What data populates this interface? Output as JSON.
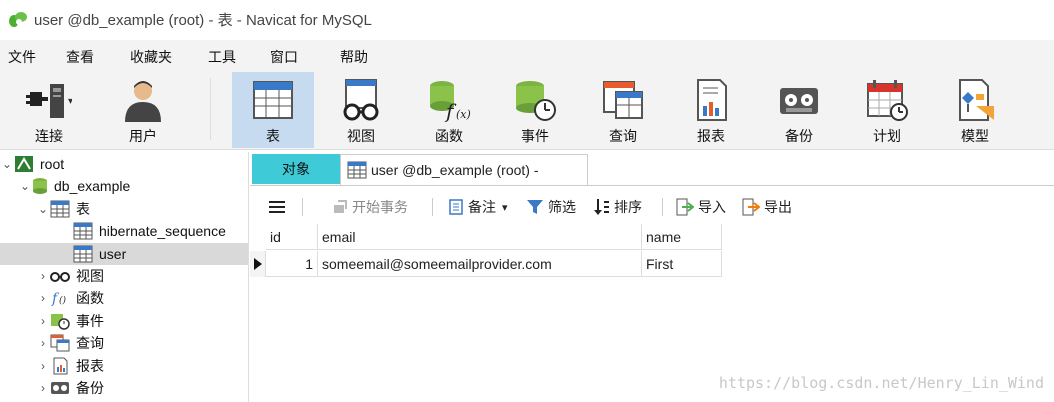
{
  "window": {
    "title": "user @db_example (root) - 表 - Navicat for MySQL"
  },
  "menu": [
    "文件",
    "查看",
    "收藏夹",
    "工具",
    "窗口",
    "帮助"
  ],
  "toolbar": {
    "connect": "连接",
    "user": "用户",
    "table": "表",
    "view": "视图",
    "function": "函数",
    "event": "事件",
    "query": "查询",
    "report": "报表",
    "backup": "备份",
    "schedule": "计划",
    "model": "模型"
  },
  "tree": {
    "root": "root",
    "database": "db_example",
    "tables_group": "表",
    "tables": [
      "hibernate_sequence",
      "user"
    ],
    "views": "视图",
    "functions": "函数",
    "events": "事件",
    "queries": "查询",
    "reports": "报表",
    "backups": "备份"
  },
  "tabs": {
    "objects": "对象",
    "active": "user @db_example (root) -"
  },
  "table_toolbar": {
    "begin_transaction": "开始事务",
    "memo": "备注",
    "filter": "筛选",
    "sort": "排序",
    "import": "导入",
    "export": "导出"
  },
  "grid": {
    "columns": [
      "id",
      "email",
      "name"
    ],
    "rows": [
      [
        "1",
        "someemail@someemailprovider.com",
        "First"
      ]
    ]
  },
  "watermark": "https://blog.csdn.net/Henry_Lin_Wind",
  "colors": {
    "active_tool_bg": "#c6dbf0",
    "objects_tab_bg": "#3ecad6",
    "logo_green": "#4caf2d"
  }
}
